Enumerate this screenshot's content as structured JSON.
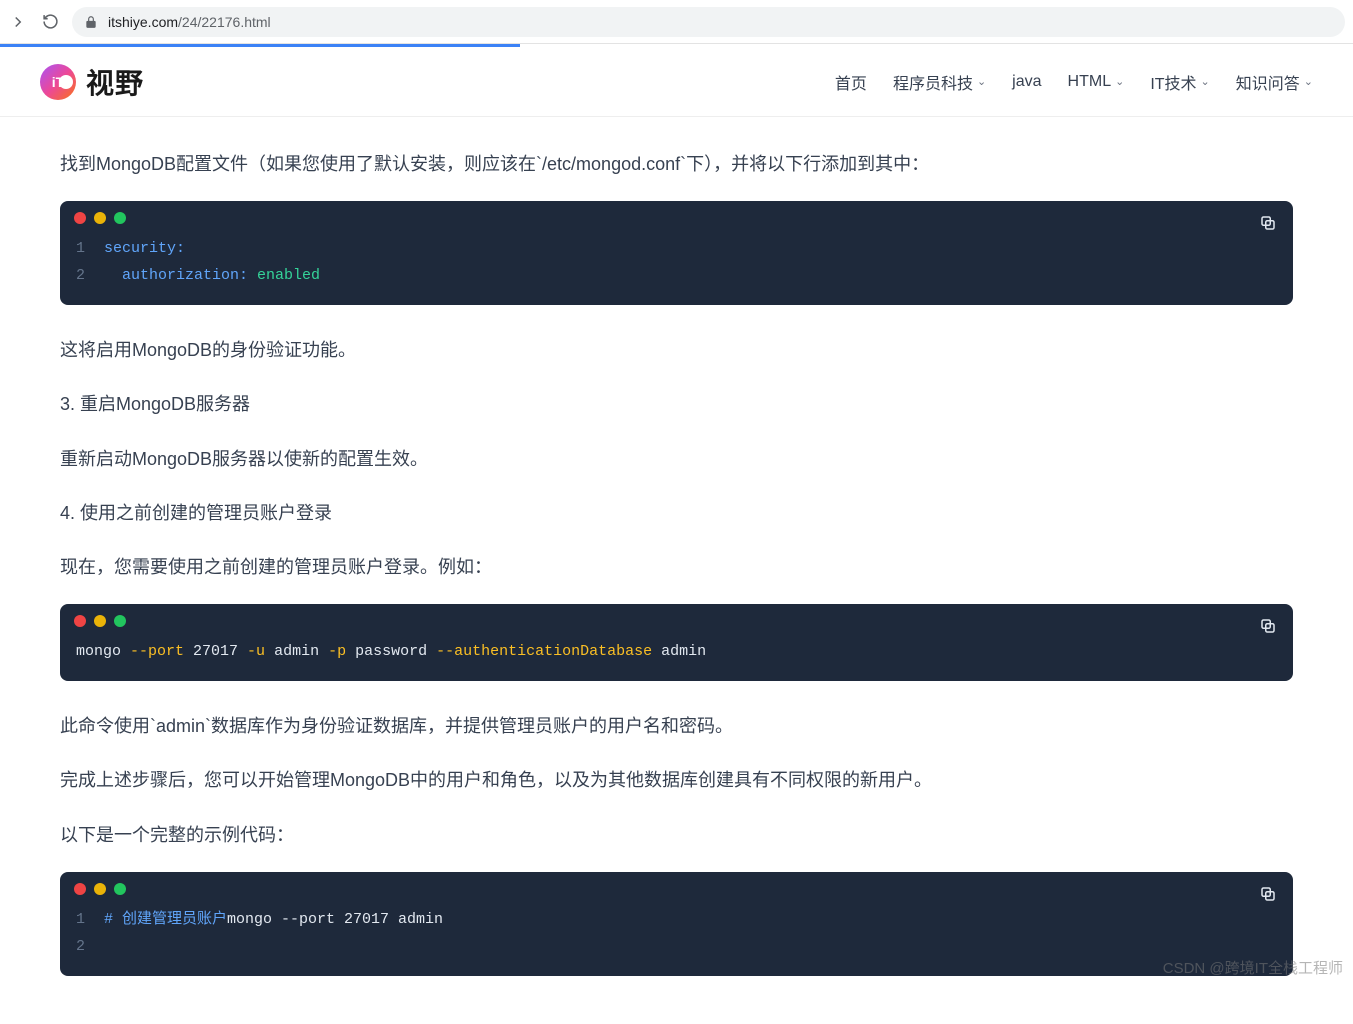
{
  "browser": {
    "url_domain": "itshiye.com",
    "url_path": "/24/22176.html"
  },
  "header": {
    "logo_text": "视野",
    "nav": [
      {
        "label": "首页",
        "dropdown": false
      },
      {
        "label": "程序员科技",
        "dropdown": true
      },
      {
        "label": "java",
        "dropdown": false
      },
      {
        "label": "HTML",
        "dropdown": true
      },
      {
        "label": "IT技术",
        "dropdown": true
      },
      {
        "label": "知识问答",
        "dropdown": true
      }
    ]
  },
  "article": {
    "p1": "找到MongoDB配置文件（如果您使用了默认安装，则应该在`/etc/mongod.conf`下），并将以下行添加到其中：",
    "code1_line1_ln": "1",
    "code1_line1_text": "security:",
    "code1_line2_ln": "2",
    "code1_line2_key": "authorization:",
    "code1_line2_val": " enabled",
    "p2": "这将启用MongoDB的身份验证功能。",
    "h3": "3. 重启MongoDB服务器",
    "p3": "重新启动MongoDB服务器以使新的配置生效。",
    "h4": "4. 使用之前创建的管理员账户登录",
    "p4": "现在，您需要使用之前创建的管理员账户登录。例如：",
    "code2_cmd": "mongo ",
    "code2_flag1": "--port",
    "code2_arg1": " 27017 ",
    "code2_flag2": "-u",
    "code2_arg2": " admin ",
    "code2_flag3": "-p",
    "code2_arg3": " password ",
    "code2_flag4": "--authenticationDatabase",
    "code2_arg4": " admin",
    "p5": "此命令使用`admin`数据库作为身份验证数据库，并提供管理员账户的用户名和密码。",
    "p6": "完成上述步骤后，您可以开始管理MongoDB中的用户和角色，以及为其他数据库创建具有不同权限的新用户。",
    "p7": "以下是一个完整的示例代码：",
    "code3_line1_ln": "1",
    "code3_line1_comment": "# 创建管理员账户",
    "code3_line1_rest": "mongo --port 27017 admin",
    "code3_line2_ln": "2"
  },
  "watermark": "CSDN @跨境IT全栈工程师"
}
